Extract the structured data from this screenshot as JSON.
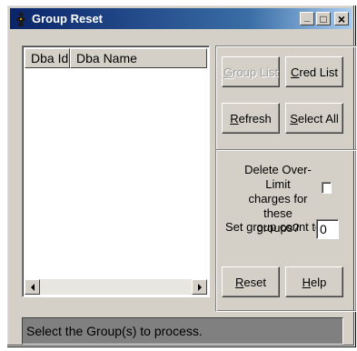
{
  "window": {
    "title": "Group Reset",
    "minimize_glyph": "_",
    "maximize_glyph": "□",
    "close_glyph": "×",
    "app_icon": "sheriff-icon"
  },
  "list": {
    "columns": [
      "Dba Id",
      "Dba Name"
    ],
    "rows": []
  },
  "buttons": {
    "group_list": {
      "mnemonic": "G",
      "rest": "roup List"
    },
    "cred_list": {
      "mnemonic": "C",
      "rest": "red List"
    },
    "refresh": {
      "mnemonic": "R",
      "rest": "efresh"
    },
    "select_all": {
      "mnemonic": "S",
      "rest": "elect All"
    },
    "reset": {
      "mnemonic": "R",
      "rest": "eset"
    },
    "help": {
      "mnemonic": "H",
      "rest": "elp"
    }
  },
  "options": {
    "delete_line1": "Delete Over-Limit",
    "delete_line2": "charges for these",
    "delete_line3": "groups?",
    "delete_checked": false,
    "count_label": "Set group count to",
    "count_value": "0"
  },
  "status": {
    "text": "Select the Group(s) to process."
  },
  "colors": {
    "title_start": "#0a246a",
    "title_end": "#a6caf0",
    "face": "#d4d0c8",
    "status_bg": "#808080"
  }
}
